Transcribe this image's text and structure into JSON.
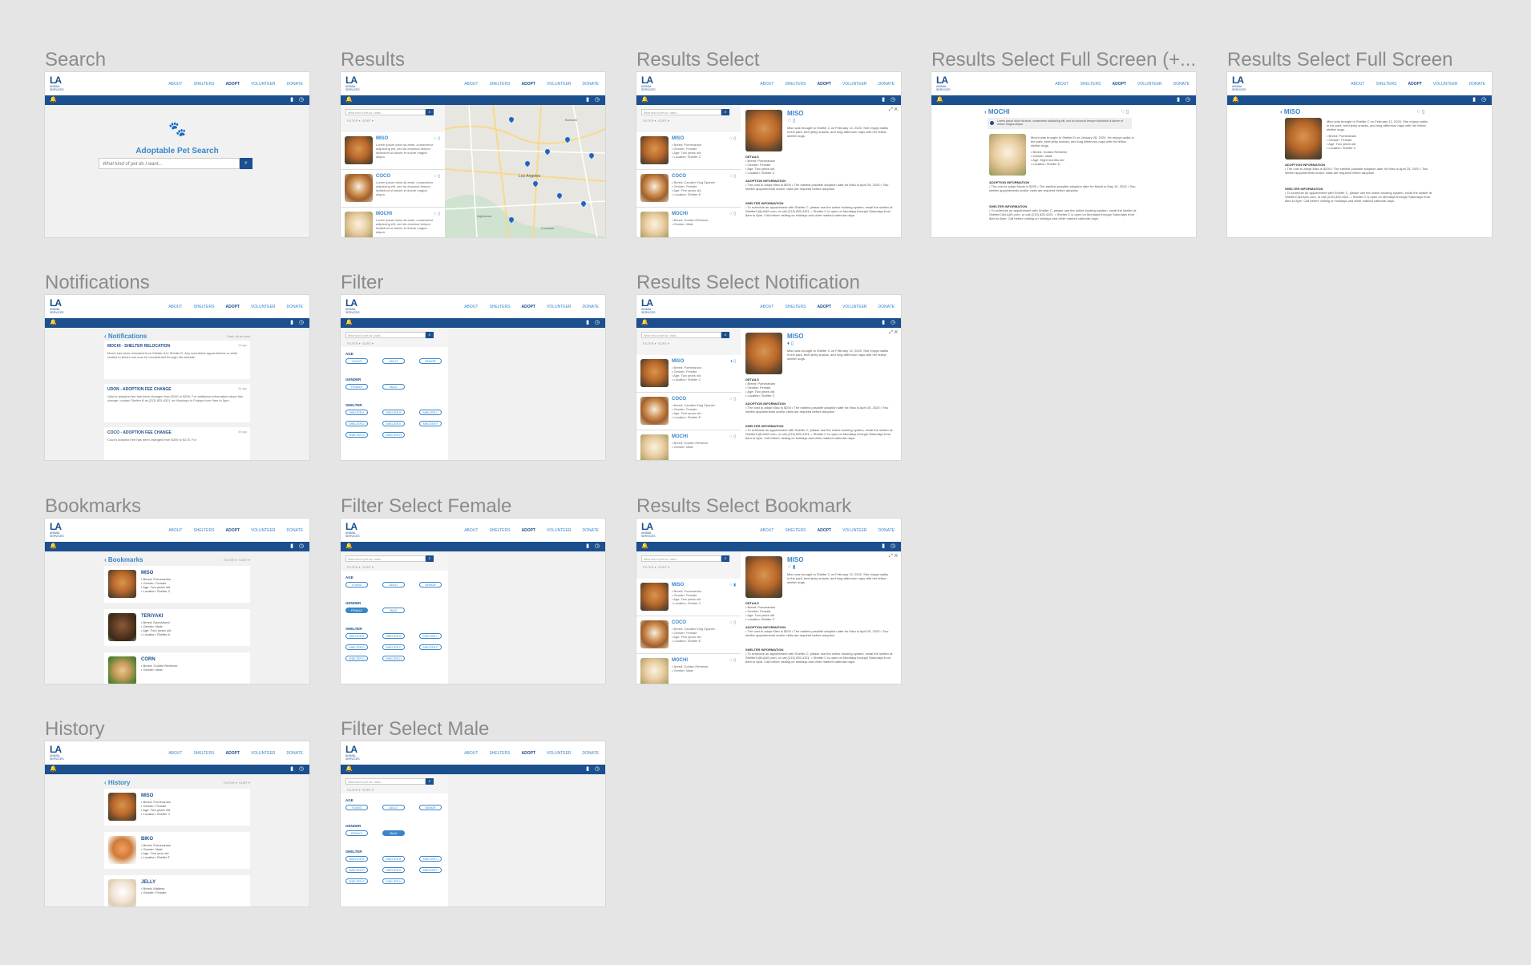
{
  "header": {
    "logo_text": "LA",
    "logo_sub": "ANIMAL SERVICES",
    "nav": [
      "ABOUT",
      "SHELTERS",
      "ADOPT",
      "VOLUNTEER",
      "DONATE"
    ]
  },
  "colors": {
    "navy": "#1b4f8e",
    "accent": "#3a86c8",
    "bg": "#e5e5e5"
  },
  "frames": {
    "search": {
      "title": "Search",
      "heading": "Adoptable Pet Search",
      "placeholder": "What kind of pet do I want..."
    },
    "results": {
      "title": "Results"
    },
    "results_select": {
      "title": "Results Select"
    },
    "results_full_plus": {
      "title": "Results Select Full Screen (+..."
    },
    "results_full": {
      "title": "Results Select Full Screen"
    },
    "notifications": {
      "title": "Notifications",
      "heading": "Notifications",
      "mark_all": "Mark all as read"
    },
    "filter": {
      "title": "Filter"
    },
    "results_notif": {
      "title": "Results Select Notification"
    },
    "bookmarks": {
      "title": "Bookmarks",
      "heading": "Bookmarks"
    },
    "filter_female": {
      "title": "Filter Select Female"
    },
    "results_bookmark": {
      "title": "Results Select Bookmark"
    },
    "history": {
      "title": "History",
      "heading": "History"
    },
    "filter_male": {
      "title": "Filter Select Male"
    }
  },
  "list": {
    "search_placeholder": "What kind of pet do I want...",
    "filter": "FILTER ▾",
    "sort": "SORT ▾",
    "lorem": "Lorem ipsum dolor sit amet, consectetur adipiscing elit, sed do eiusmod tempor incididunt ut labore et dolore magna aliqua."
  },
  "pets": {
    "miso": {
      "name": "MISO",
      "breed": "• Breed: Pomeranian",
      "gender": "• Gender: Female",
      "age": "• Age: Two years old",
      "location": "• Location: Shelter C"
    },
    "coco": {
      "name": "COCO",
      "breed": "• Breed: Cavalier King Spaniel",
      "gender": "• Gender: Female",
      "age": "• Age: Five years old",
      "location": "• Location: Shelter E"
    },
    "mochi": {
      "name": "MOCHI",
      "breed": "• Breed: Golden Retriever",
      "gender": "• Gender: Male",
      "age": "• Age: Eight months old",
      "location": "• Location: Shelter D"
    },
    "teriyaki": {
      "name": "TERIYAKI",
      "breed": "• Breed: Dachshund",
      "gender": "• Gender: Male",
      "age": "• Age: Four years old",
      "location": "• Location: Shelter A"
    },
    "corn": {
      "name": "CORN",
      "breed": "• Breed: Golden Retriever",
      "gender": "• Gender: Male"
    },
    "biko": {
      "name": "BIKO",
      "breed": "• Breed: Pomeranian",
      "gender": "• Gender: Male",
      "age": "• Age: One year old",
      "location": "• Location: Shelter F"
    },
    "jelly": {
      "name": "JELLY",
      "breed": "• Breed: Maltese",
      "gender": "• Gender: Female"
    }
  },
  "detail": {
    "miso_intro": "Miso was brought to Shelter C on February 12, 2020. She enjoys walks in the park, beef jerky snacks, and long afternoon naps with her fellow shelter dogs.",
    "mochi_intro": "Mochi was brought to Shelter D on January 26, 2020. He enjoys walks in the park, beef jerky snacks, and long afternoon naps with his fellow shelter dogs.",
    "details_h": "DETAILS",
    "adoption_h": "ADOPTION INFORMATION",
    "adoption_miso": "• The cost to adopt Miso is $200 • The earliest possible adoption date for Miso is April 25, 2020 • Two shelter appointments and/or visits are required before adoption",
    "adoption_mochi": "• The cost to adopt Mochi is $200 • The earliest possible adoption date for Mochi is May 15, 2020 • Two shelter appointments and/or visits are required before adoption",
    "shelter_h": "SHELTER INFORMATION",
    "shelter_c": "• To schedule an appointment with Shelter C, please use the online booking system, email the shelter at ShelterC@LAAS.com, or call (213) 825-4321. • Shelter C is open on Mondays through Saturdays from 8am to 8pm. Call before visiting on holidays and other marked calendar days.",
    "banner": "Lorem ipsum dolor sit amet, consectetur adipiscing elit, sed do eiusmod tempor incididunt ut labore et dolore magna aliqua."
  },
  "notifications": [
    {
      "title": "MOCHI - SHELTER RELOCATION",
      "age": "1d ago",
      "text": "Mochi has been relocated from Shelter A to Shelter D. Any scheduled appointments or visits related to Mochi can now be rescheduled through the website."
    },
    {
      "title": "UDON - ADOPTION FEE CHANGE",
      "age": "3d ago",
      "text": "Udon's adoption fee has been changed from $190 to $200. For additional information about this change, contact Shelter B at (213) 825-4321 on Mondays to Fridays from 9am to 5pm."
    },
    {
      "title": "COCO - ADOPTION FEE CHANGE",
      "age": "5d ago",
      "text": "Coco's adoption fee has been changed from $200 to $175. For"
    }
  ],
  "filter": {
    "age_label": "AGE",
    "ages": [
      "YOUNG",
      "ADULT",
      "SENIOR"
    ],
    "gender_label": "GENDER",
    "genders": [
      "FEMALE",
      "MALE"
    ],
    "shelter_label": "SHELTER",
    "shelters": [
      "SHELTER A",
      "SHELTER B",
      "SHELTER C",
      "SHELTER D",
      "SHELTER E",
      "SHELTER F",
      "SHELTER G",
      "SHELTER H"
    ]
  },
  "map_labels": [
    "Los Angeles",
    "Inglewood",
    "Compton",
    "Burbank"
  ]
}
